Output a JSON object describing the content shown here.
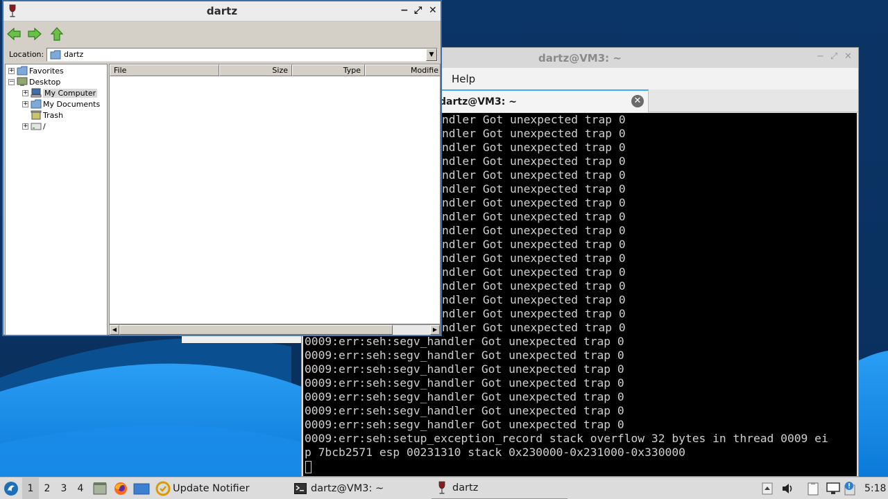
{
  "file_manager": {
    "title": "dartz",
    "controls": {
      "minimize": "−",
      "maximize": "⤢",
      "close": "✕"
    },
    "toolbar": {
      "back_icon": "green-left-arrow-icon",
      "forward_icon": "green-right-arrow-icon",
      "up_icon": "green-up-arrow-icon"
    },
    "location": {
      "label": "Location:",
      "value": "dartz",
      "dropdown": "▼"
    },
    "tree": {
      "favorites": {
        "exp": "+",
        "label": "Favorites"
      },
      "desktop": {
        "exp": "−",
        "label": "Desktop"
      },
      "my_computer": {
        "exp": "+",
        "label": "My Computer"
      },
      "my_documents": {
        "exp": "+",
        "label": "My Documents"
      },
      "trash": {
        "label": "Trash"
      },
      "root": {
        "exp": "+",
        "label": "/"
      }
    },
    "columns": {
      "file": "File",
      "size": "Size",
      "type": "Type",
      "modified": "Modifie"
    },
    "scroll": {
      "left": "◀",
      "right": "▶"
    }
  },
  "terminal": {
    "window_title": "dartz@VM3: ~",
    "controls": {
      "minimize": "−",
      "maximize": "⤢",
      "close": "✕"
    },
    "menu": {
      "item1": "Help"
    },
    "tab": {
      "label": "dartz@VM3: ~",
      "close": "✕"
    },
    "lines": [
      "ndler Got unexpected trap 0",
      "ndler Got unexpected trap 0",
      "ndler Got unexpected trap 0",
      "ndler Got unexpected trap 0",
      "ndler Got unexpected trap 0",
      "ndler Got unexpected trap 0",
      "ndler Got unexpected trap 0",
      "ndler Got unexpected trap 0",
      "ndler Got unexpected trap 0",
      "ndler Got unexpected trap 0",
      "ndler Got unexpected trap 0",
      "ndler Got unexpected trap 0",
      "ndler Got unexpected trap 0",
      "ndler Got unexpected trap 0",
      "ndler Got unexpected trap 0",
      "ndler Got unexpected trap 0",
      "0009:err:seh:segv_handler Got unexpected trap 0",
      "0009:err:seh:segv_handler Got unexpected trap 0",
      "0009:err:seh:segv_handler Got unexpected trap 0",
      "0009:err:seh:segv_handler Got unexpected trap 0",
      "0009:err:seh:segv_handler Got unexpected trap 0",
      "0009:err:seh:segv_handler Got unexpected trap 0",
      "0009:err:seh:segv_handler Got unexpected trap 0",
      "0009:err:seh:setup_exception_record stack overflow 32 bytes in thread 0009 ei",
      "p 7bcb2571 esp 00231310 stack 0x230000-0x231000-0x330000"
    ]
  },
  "taskbar": {
    "menu_icon": "start-menu-icon",
    "workspaces": [
      "1",
      "2",
      "3",
      "4"
    ],
    "update_notifier": "Update Notifier",
    "terminal_task": "dartz@VM3: ~",
    "wine_task": "dartz",
    "clock": "5:18"
  }
}
